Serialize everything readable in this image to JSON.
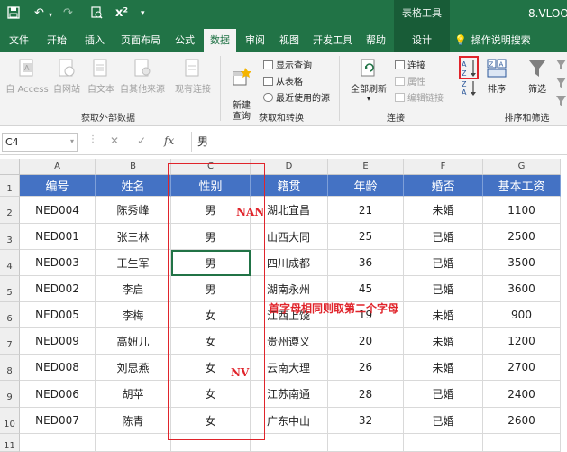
{
  "titlebar": {
    "tools_label": "表格工具",
    "doc_title": "8.VLOO"
  },
  "tabs": [
    {
      "label": "文件"
    },
    {
      "label": "开始"
    },
    {
      "label": "插入"
    },
    {
      "label": "页面布局"
    },
    {
      "label": "公式"
    },
    {
      "label": "数据"
    },
    {
      "label": "审阅"
    },
    {
      "label": "视图"
    },
    {
      "label": "开发工具"
    },
    {
      "label": "帮助"
    },
    {
      "label": "设计"
    }
  ],
  "tell_me": "操作说明搜索",
  "ribbon": {
    "external": {
      "items": [
        "自 Access",
        "自网站",
        "自文本",
        "自其他来源",
        "现有连接"
      ],
      "label": "获取外部数据"
    },
    "transform": {
      "new_query": "新建\n查询",
      "show_query": "显示查询",
      "from_table": "从表格",
      "recent_sources": "最近使用的源",
      "label": "获取和转换"
    },
    "connections": {
      "refresh_all": "全部刷新",
      "connections": "连接",
      "properties": "属性",
      "edit_links": "编辑链接",
      "label": "连接"
    },
    "sort": {
      "sort_label": "排序",
      "filter_label": "筛选",
      "label": "排序和筛选"
    }
  },
  "formula_bar": {
    "name_box": "C4",
    "cancel": "✕",
    "enter": "✓",
    "fx": "fx",
    "value": "男"
  },
  "sheet": {
    "columns": [
      "A",
      "B",
      "C",
      "D",
      "E",
      "F",
      "G"
    ],
    "rows": [
      "1",
      "2",
      "3",
      "4",
      "5",
      "6",
      "7",
      "8",
      "9",
      "10",
      "11"
    ],
    "header": [
      "编号",
      "姓名",
      "性别",
      "籍贯",
      "年龄",
      "婚否",
      "基本工资"
    ],
    "data": [
      [
        "NED004",
        "陈秀峰",
        "男",
        "湖北宜昌",
        "21",
        "未婚",
        "1100"
      ],
      [
        "NED001",
        "张三林",
        "男",
        "山西大同",
        "25",
        "已婚",
        "2500"
      ],
      [
        "NED003",
        "王生军",
        "男",
        "四川成都",
        "36",
        "已婚",
        "3500"
      ],
      [
        "NED002",
        "李启",
        "男",
        "湖南永州",
        "45",
        "已婚",
        "3600"
      ],
      [
        "NED005",
        "李梅",
        "女",
        "江西上饶",
        "19",
        "未婚",
        "900"
      ],
      [
        "NED009",
        "高妞儿",
        "女",
        "贵州遵义",
        "20",
        "未婚",
        "1200"
      ],
      [
        "NED008",
        "刘思燕",
        "女",
        "云南大理",
        "26",
        "未婚",
        "2700"
      ],
      [
        "NED006",
        "胡苹",
        "女",
        "江苏南通",
        "28",
        "已婚",
        "2400"
      ],
      [
        "NED007",
        "陈青",
        "女",
        "广东中山",
        "32",
        "已婚",
        "2600"
      ]
    ]
  },
  "annotations": {
    "nan": "NAN",
    "nv": "NV",
    "note": "首字母相同则取第二个字母"
  },
  "colors": {
    "excel_green": "#217346",
    "header_blue": "#4472c4",
    "annotation_red": "#e0242b"
  }
}
